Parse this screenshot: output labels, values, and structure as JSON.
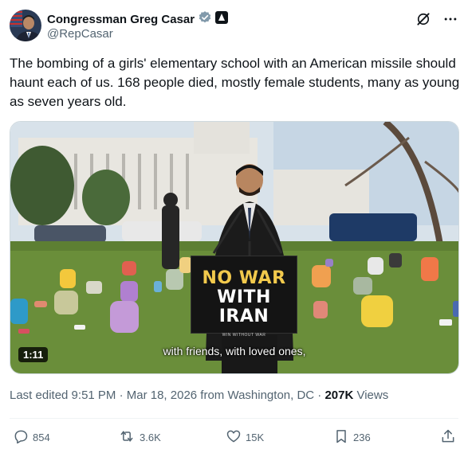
{
  "author": {
    "display_name": "Congressman Greg Casar",
    "handle": "@RepCasar",
    "avatar_icon": "avatar",
    "verified_icon": "verified-badge-icon",
    "affiliation_icon": "government-affiliation-icon"
  },
  "header_icons": [
    "grok-icon",
    "more-options-icon"
  ],
  "tweet": {
    "text": "The bombing of a girls' elementary school with an American missile should haunt each of us. 168 people died, mostly female students, many as young as seven years old."
  },
  "media": {
    "duration": "1:11",
    "caption": "with friends, with loved ones,",
    "sign_line1": "NO WAR",
    "sign_line2": "WITH IRAN",
    "sign_small": "WIN WITHOUT WAR"
  },
  "meta": {
    "edited": "Last edited 9:51 PM · Mar 18, 2026 from Washington, DC · ",
    "views_count": "207K",
    "views_label": " Views"
  },
  "actions": {
    "replies": "854",
    "reposts": "3.6K",
    "likes": "15K",
    "bookmarks": "236"
  },
  "colors": {
    "text": "#0f1419",
    "secondary": "#536471",
    "verified": "#829aab",
    "sign_yellow": "#f2c94c"
  }
}
